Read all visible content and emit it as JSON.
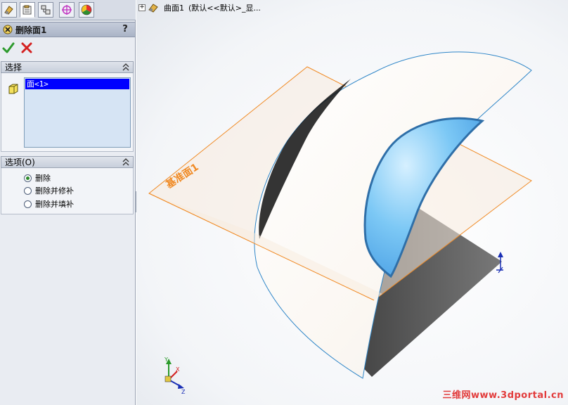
{
  "property_manager": {
    "title": "删除面1",
    "help": "?",
    "selection": {
      "header": "选择",
      "item": "面<1>"
    },
    "options": {
      "header": "选项(O)",
      "choices": [
        "删除",
        "删除并修补",
        "删除并填补"
      ],
      "selected": "删除"
    }
  },
  "feature_tree": {
    "expand_symbol": "+",
    "part_name": "曲面1",
    "config": "(默认<<默认>_显..."
  },
  "graphics": {
    "plane_label": "基准面1"
  },
  "watermark": "三维网www.3dportal.cn",
  "colors": {
    "selection_highlight": "#0000ff",
    "plane_edge": "#f08a24",
    "face_blue": "#5db8f0",
    "ok_green": "#2d9a2d",
    "cancel_red": "#d42020"
  }
}
